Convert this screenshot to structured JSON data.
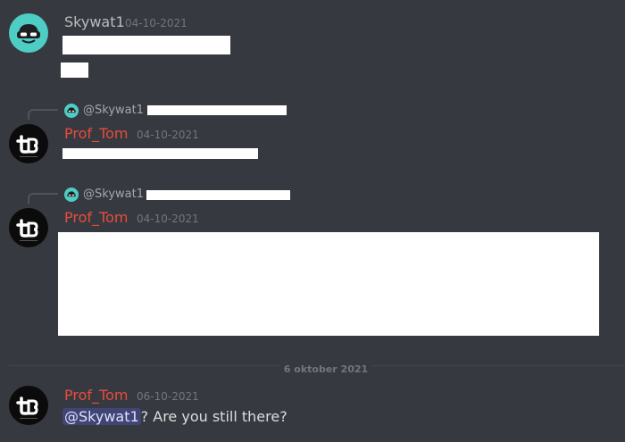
{
  "messages": [
    {
      "author": "Skywat1",
      "timestamp": "04-10-2021"
    },
    {
      "reply_to": "@Skywat1",
      "author": "Prof_Tom",
      "timestamp": "04-10-2021"
    },
    {
      "reply_to": "@Skywat1",
      "author": "Prof_Tom",
      "timestamp": "04-10-2021"
    },
    {
      "author": "Prof_Tom",
      "timestamp": "06-10-2021",
      "mention": "@Skywat1",
      "text": "? Are you still there?"
    }
  ],
  "date_divider": "6 oktober 2021",
  "colors": {
    "background": "#36393f",
    "author_red": "#e74c3c",
    "avatar_teal": "#4ecdc4"
  }
}
